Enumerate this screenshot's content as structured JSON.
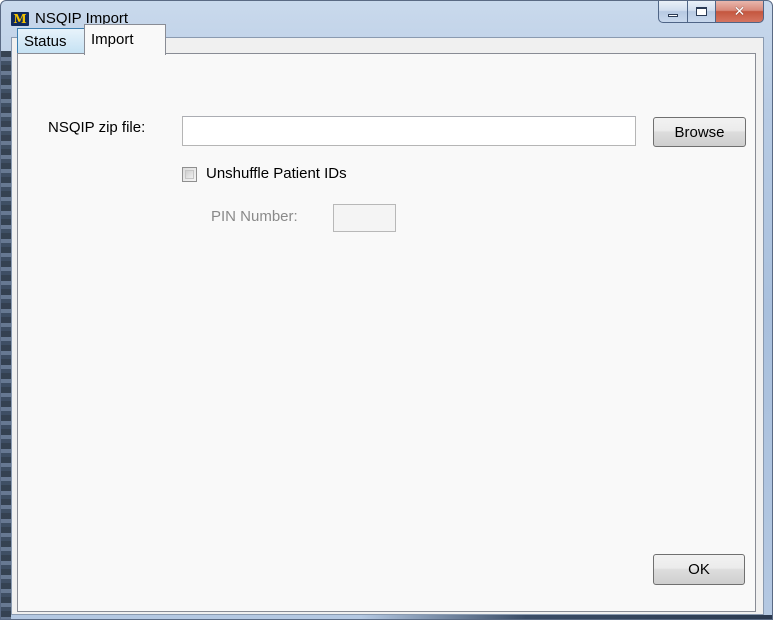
{
  "window": {
    "title": "NSQIP Import",
    "app_icon_letter": "M",
    "icon": "app-logo-icon",
    "caption_buttons": {
      "minimize": "minimize-icon",
      "maximize": "maximize-icon",
      "close": "close-icon"
    }
  },
  "tabs": [
    {
      "label": "Status",
      "selected": false
    },
    {
      "label": "Import",
      "selected": true
    }
  ],
  "import": {
    "zip_label": "NSQIP zip file:",
    "zip_value": "",
    "browse_label": "Browse",
    "unshuffle_label": "Unshuffle Patient IDs",
    "unshuffle_checked": false,
    "pin_label": "PIN Number:",
    "pin_value": "",
    "pin_enabled": false,
    "ok_label": "OK"
  },
  "colors": {
    "status_tab": "#c4e1f3",
    "panel_bg": "#f9f9f9",
    "disabled_text": "#8a8a8a"
  }
}
